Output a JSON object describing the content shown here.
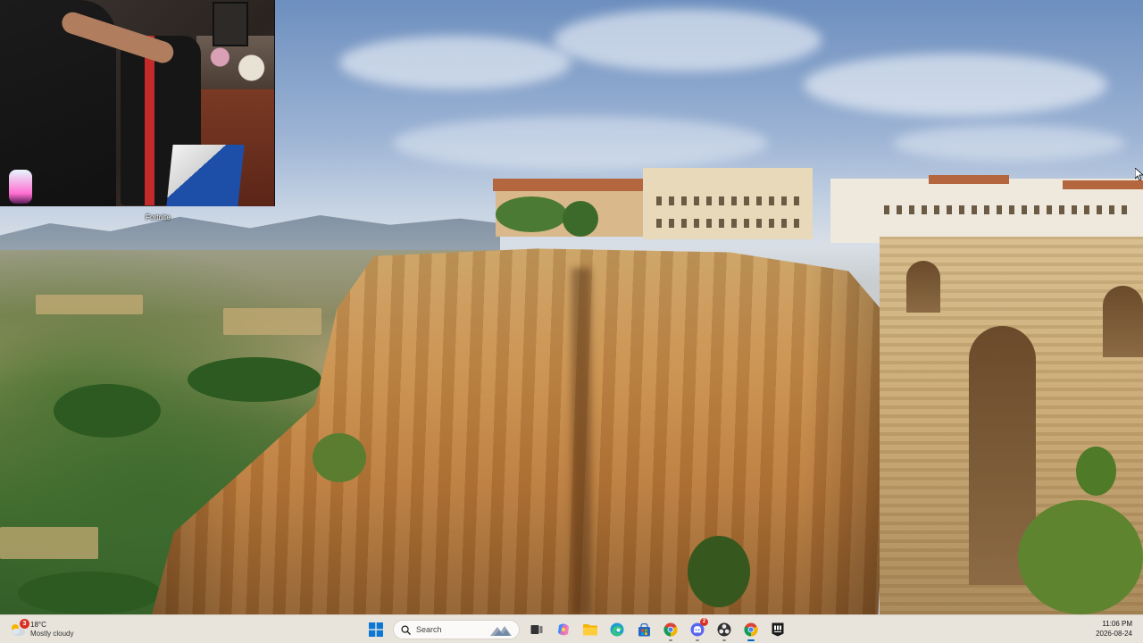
{
  "overlay": {
    "game_label": "Fortnite"
  },
  "taskbar": {
    "weather": {
      "temperature": "18°C",
      "condition": "Mostly cloudy",
      "notification_count": "3",
      "icon": "partly-cloudy-icon"
    },
    "search": {
      "placeholder": "Search"
    },
    "apps": [
      {
        "name": "windows-start",
        "icon": "windows-logo-icon"
      },
      {
        "name": "task-view",
        "icon": "task-view-icon"
      },
      {
        "name": "copilot",
        "icon": "copilot-icon"
      },
      {
        "name": "file-explorer",
        "icon": "folder-icon"
      },
      {
        "name": "edge",
        "icon": "edge-icon"
      },
      {
        "name": "microsoft-store",
        "icon": "store-icon"
      },
      {
        "name": "chrome",
        "icon": "chrome-icon"
      },
      {
        "name": "discord",
        "icon": "discord-icon",
        "badge": "2"
      },
      {
        "name": "obs",
        "icon": "obs-icon"
      },
      {
        "name": "chrome-2",
        "icon": "chrome-icon"
      },
      {
        "name": "epic-games",
        "icon": "epic-games-icon"
      }
    ],
    "clock": {
      "time": "11:06 PM",
      "date": "2026-08-24"
    }
  },
  "colors": {
    "taskbar_bg": "#ece7de",
    "accent": "#0067c0",
    "badge": "#d93025"
  }
}
